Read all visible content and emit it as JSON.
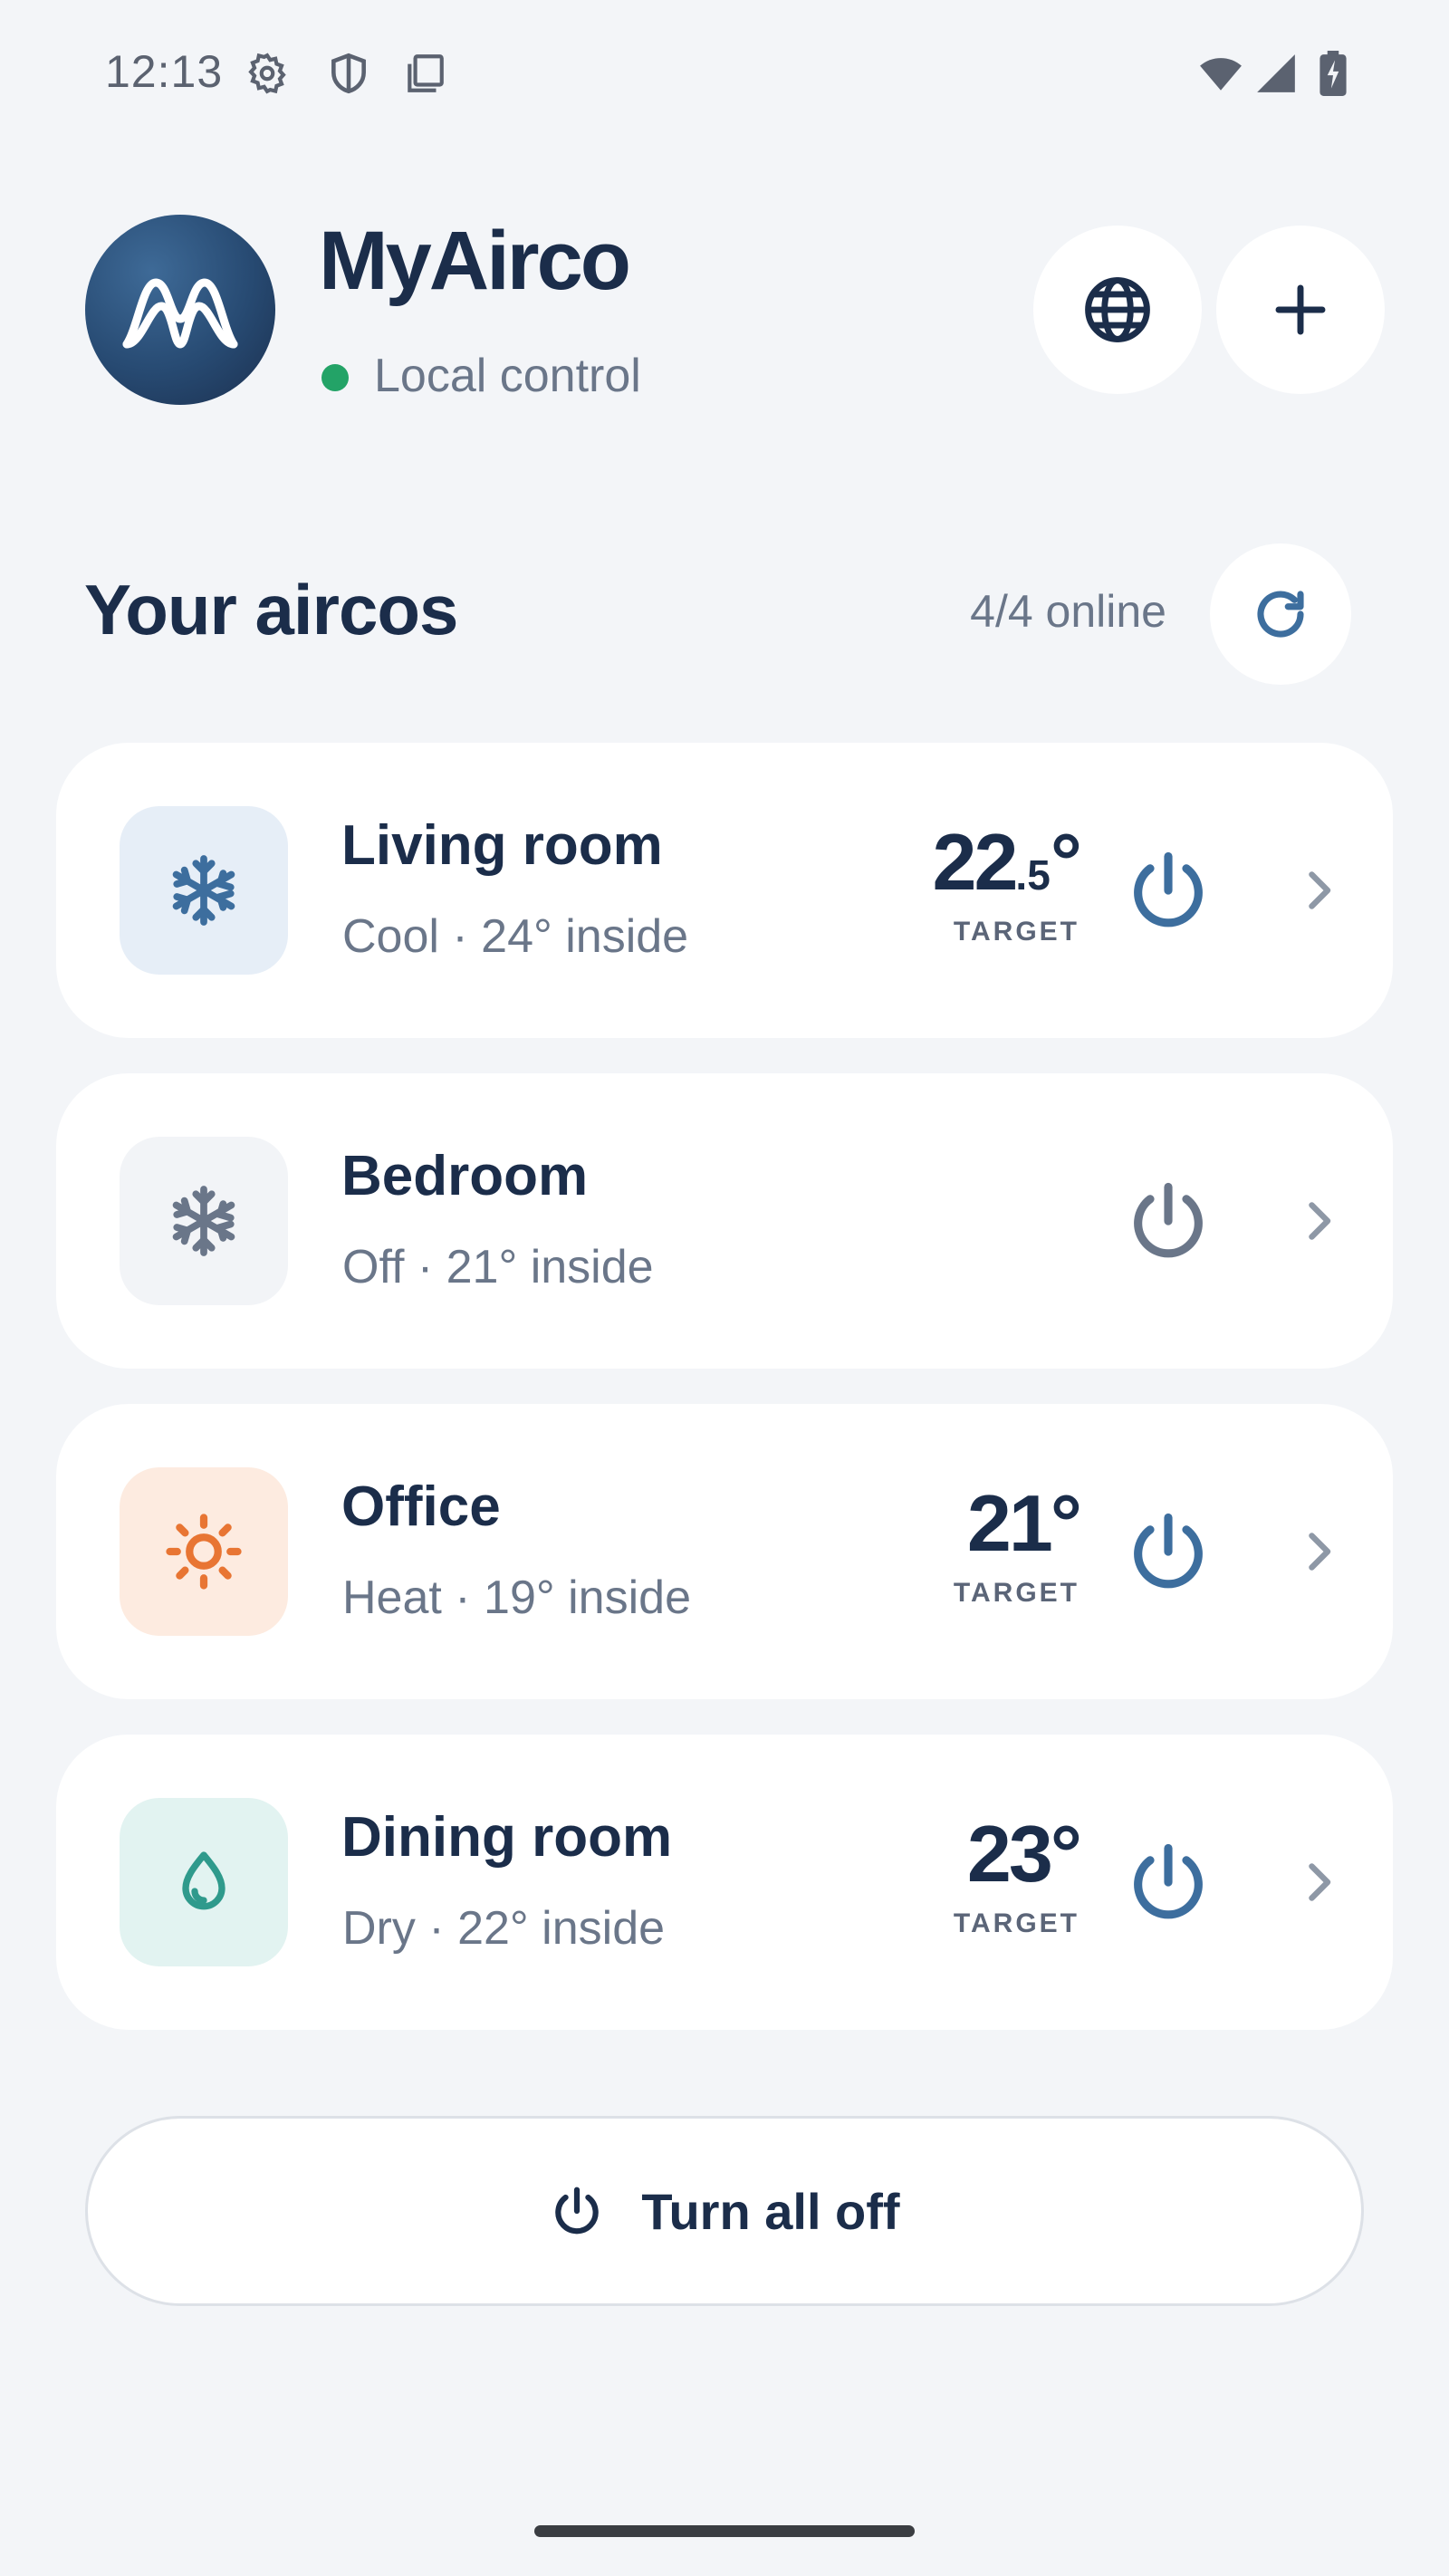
{
  "status_bar": {
    "time": "12:13",
    "icons": [
      "gear-icon",
      "shield-icon",
      "copy-icon",
      "wifi-icon",
      "signal-icon",
      "battery-charging-icon"
    ]
  },
  "header": {
    "title": "MyAirco",
    "status": "Local control",
    "status_color": "#23a367",
    "buttons": [
      "globe-icon",
      "plus-icon"
    ]
  },
  "section": {
    "title": "Your aircos",
    "online": "4/4 online"
  },
  "devices": [
    {
      "name": "Living room",
      "subtitle": "Cool · 24° inside",
      "mode_icon": "snowflake-icon",
      "target_int": "22",
      "target_dec": ".5",
      "target_deg": "°",
      "target_label": "TARGET",
      "power": "on"
    },
    {
      "name": "Bedroom",
      "subtitle": "Off · 21° inside",
      "mode_icon": "snowflake-icon",
      "power": "off"
    },
    {
      "name": "Office",
      "subtitle": "Heat · 19° inside",
      "mode_icon": "sun-icon",
      "target_int": "21",
      "target_deg": "°",
      "target_label": "TARGET",
      "power": "on"
    },
    {
      "name": "Dining room",
      "subtitle": "Dry · 22° inside",
      "mode_icon": "droplet-icon",
      "target_int": "23",
      "target_deg": "°",
      "target_label": "TARGET",
      "power": "on"
    }
  ],
  "footer": {
    "turn_all_off": "Turn all off"
  },
  "colors": {
    "primary": "#1b2d4a",
    "accent_blue": "#3d6e9e",
    "heat": "#e87533",
    "dry": "#2f9a8c",
    "muted": "#6a7689"
  }
}
